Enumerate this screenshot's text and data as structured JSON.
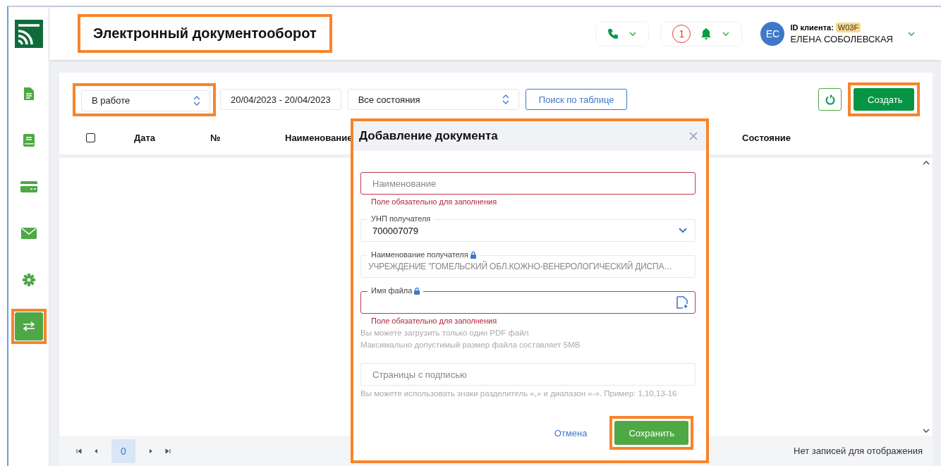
{
  "sidebar": {
    "items": [
      {
        "kind": "document",
        "selected": false,
        "highlighted": false
      },
      {
        "kind": "book",
        "selected": false,
        "highlighted": false
      },
      {
        "kind": "card",
        "selected": false,
        "highlighted": false
      },
      {
        "kind": "mail",
        "selected": false,
        "highlighted": false
      },
      {
        "kind": "gear",
        "selected": false,
        "highlighted": false
      },
      {
        "kind": "transfer",
        "selected": true,
        "highlighted": true
      }
    ]
  },
  "header": {
    "title": "Электронный документооборот",
    "title_highlighted": true,
    "notifications": {
      "count": "1"
    },
    "user": {
      "initials": "ЕС",
      "client_id_label": "ID клиента:",
      "client_id": "W03F",
      "name": "ЕЛЕНА СОБОЛЕВСКАЯ"
    }
  },
  "toolbar": {
    "status_filter": {
      "value": "В работе",
      "highlighted": true
    },
    "date_range": "20/04/2023 - 20/04/2023",
    "state_filter": {
      "value": "Все состояния"
    },
    "search_button": "Поиск по таблице",
    "create_button": {
      "label": "Создать",
      "highlighted": true
    }
  },
  "table": {
    "select_all_checked": false,
    "columns": [
      "Дата",
      "№",
      "Наименование",
      "Состояние"
    ],
    "pagination": {
      "page": "0"
    },
    "empty_message": "Нет записей для отображения"
  },
  "dialog": {
    "title": "Добавление документа",
    "highlighted": true,
    "fields": [
      {
        "kind": "text",
        "placeholder": "Наименование",
        "invalid": true,
        "error": "Поле обязательно для заполнения"
      },
      {
        "kind": "select",
        "label": "УНП получателя",
        "value": "700007079",
        "invalid": false
      },
      {
        "kind": "readonly",
        "label": "Наименование получателя",
        "locked": true,
        "value": "УЧРЕЖДЕНИЕ \"ГОМЕЛЬСКИЙ ОБЛ.КОЖНО-ВЕНЕРОЛОГИЧЕСКИЙ ДИСПА…",
        "invalid": false
      },
      {
        "kind": "file",
        "label": "Имя файла",
        "locked": true,
        "invalid": true,
        "error": "Поле обязательно для заполнения",
        "hints": [
          "Вы можете загрузить только один PDF файл",
          "Максимально допустимый размер файла составляет 5MB"
        ]
      },
      {
        "kind": "text",
        "placeholder": "Страницы с подписью",
        "invalid": false,
        "hints": [
          "Вы можете использовать знаки разделитель «,» и диапазон «-». Пример: 1,10,13-16"
        ]
      }
    ],
    "cancel_button": "Отмена",
    "save_button": {
      "label": "Сохранить",
      "highlighted": true
    }
  }
}
